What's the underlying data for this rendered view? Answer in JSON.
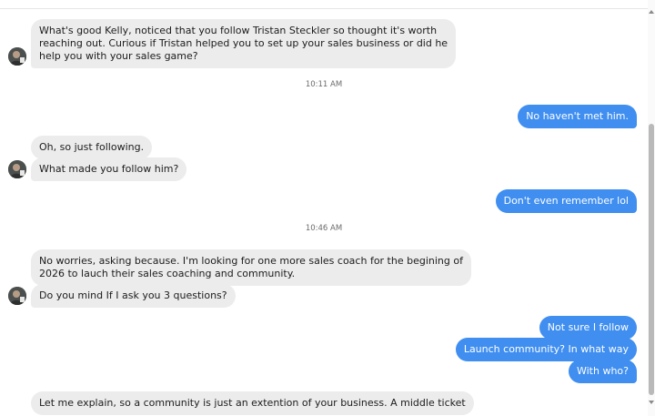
{
  "colors": {
    "incoming_bubble": "#ececec",
    "outgoing_bubble": "#3f8ef0",
    "outgoing_text": "#ffffff",
    "timestamp": "#6b6b6b"
  },
  "thread": {
    "messages": [
      {
        "direction": "incoming",
        "lines": [
          "What's good Kelly, noticed that you follow Tristan Steckler so thought it's worth",
          "reaching out. Curious if Tristan helped you to set up your sales business or did he",
          "help you with your sales game?"
        ]
      },
      {
        "timestamp": "10:11 AM"
      },
      {
        "direction": "outgoing",
        "lines": [
          "No haven't met him."
        ]
      },
      {
        "direction": "incoming",
        "lines": [
          "Oh, so just following."
        ]
      },
      {
        "direction": "incoming",
        "lines": [
          "What made you follow him?"
        ]
      },
      {
        "direction": "outgoing",
        "lines": [
          "Don't even remember lol"
        ]
      },
      {
        "timestamp": "10:46 AM"
      },
      {
        "direction": "incoming",
        "lines": [
          "No worries, asking because. I'm looking for one more sales coach for the begining of",
          "2026 to lauch their sales coaching and community."
        ]
      },
      {
        "direction": "incoming",
        "lines": [
          "Do you mind If I ask you 3 questions?"
        ]
      },
      {
        "direction": "outgoing",
        "lines": [
          "Not sure I follow"
        ]
      },
      {
        "direction": "outgoing",
        "lines": [
          "Launch community? In what way"
        ]
      },
      {
        "direction": "outgoing",
        "lines": [
          "With who?"
        ]
      },
      {
        "direction": "incoming",
        "lines": [
          "Let me explain, so a community is just an extention of your business. A middle ticket"
        ]
      }
    ]
  },
  "icons": {
    "avatar": "contact-avatar",
    "scroll_up": "triangle-up",
    "scroll_down": "triangle-down"
  }
}
